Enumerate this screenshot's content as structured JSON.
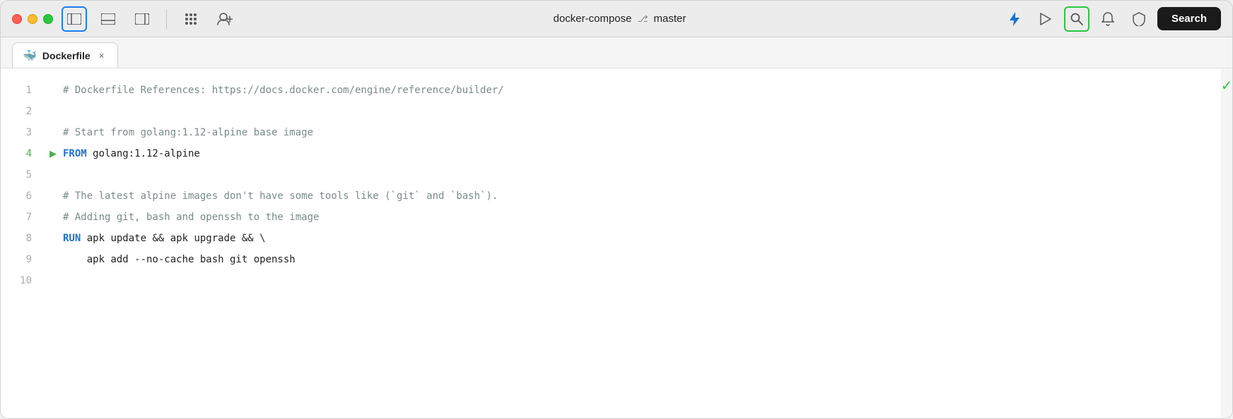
{
  "window": {
    "title": "docker-compose",
    "branch": "master"
  },
  "titlebar": {
    "traffic_lights": [
      "red",
      "yellow",
      "green"
    ],
    "layout_btn_label": "sidebar",
    "layout_btn2_label": "bottom-panel",
    "layout_btn3_label": "right-panel",
    "grid_btn_label": "apps-grid",
    "user_btn_label": "add-user",
    "title": "docker-compose",
    "branch_icon": "⎇",
    "branch": "master",
    "lightning_icon": "⚡",
    "run_icon": "▶",
    "search_icon": "🔍",
    "bell_icon": "🔔",
    "shield_icon": "⬡",
    "search_button_label": "Search"
  },
  "tab": {
    "icon": "🐳",
    "label": "Dockerfile",
    "close_label": "×"
  },
  "code": {
    "lines": [
      {
        "num": 1,
        "gutter": "",
        "content": "# Dockerfile References: https://docs.docker.com/engine/reference/builder/",
        "type": "comment"
      },
      {
        "num": 2,
        "gutter": "",
        "content": "",
        "type": "empty"
      },
      {
        "num": 3,
        "gutter": "",
        "content": "# Start from golang:1.12-alpine base image",
        "type": "comment"
      },
      {
        "num": 4,
        "gutter": "▶",
        "content": "FROM golang:1.12-alpine",
        "type": "keyword-line"
      },
      {
        "num": 5,
        "gutter": "",
        "content": "",
        "type": "empty"
      },
      {
        "num": 6,
        "gutter": "",
        "content": "# The latest alpine images don't have some tools like (`git` and `bash`).",
        "type": "comment"
      },
      {
        "num": 7,
        "gutter": "",
        "content": "# Adding git, bash and openssh to the image",
        "type": "comment"
      },
      {
        "num": 8,
        "gutter": "",
        "content": "RUN apk update && apk upgrade && \\",
        "type": "command-line"
      },
      {
        "num": 9,
        "gutter": "",
        "content": "    apk add --no-cache bash git openssh",
        "type": "text"
      },
      {
        "num": 10,
        "gutter": "",
        "content": "",
        "type": "empty"
      }
    ]
  },
  "status": {
    "check_icon": "✓"
  }
}
